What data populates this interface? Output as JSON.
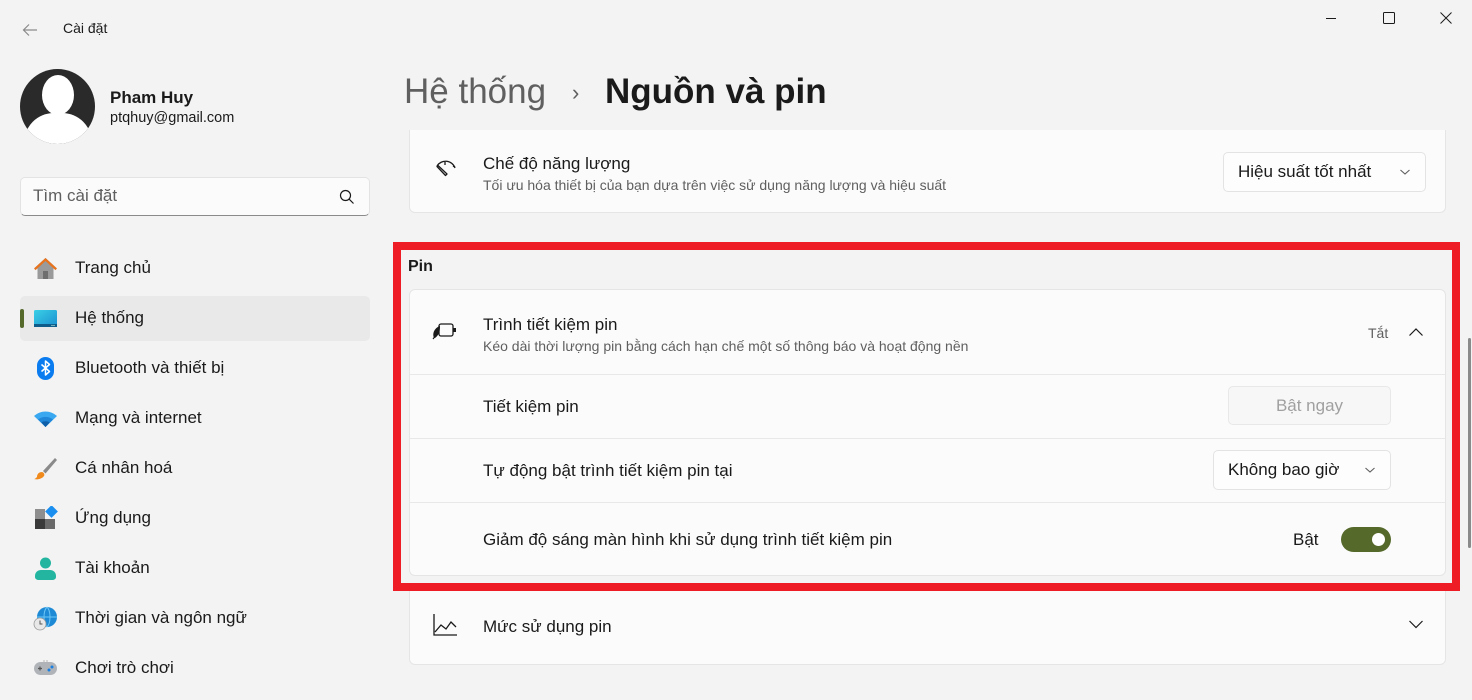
{
  "window": {
    "title": "Cài đặt",
    "controls": {
      "minimize": "minimize",
      "maximize": "maximize",
      "close": "close"
    }
  },
  "profile": {
    "name": "Pham Huy",
    "email": "ptqhuy@gmail.com"
  },
  "search": {
    "placeholder": "Tìm cài đặt",
    "value": ""
  },
  "sidebar": {
    "selected_index": 1,
    "accent": "#55692b",
    "items": [
      {
        "label": "Trang chủ",
        "icon": "home-icon"
      },
      {
        "label": "Hệ thống",
        "icon": "system-icon"
      },
      {
        "label": "Bluetooth và thiết bị",
        "icon": "bluetooth-icon"
      },
      {
        "label": "Mạng và internet",
        "icon": "wifi-icon"
      },
      {
        "label": "Cá nhân hoá",
        "icon": "paintbrush-icon"
      },
      {
        "label": "Ứng dụng",
        "icon": "apps-icon"
      },
      {
        "label": "Tài khoản",
        "icon": "account-icon"
      },
      {
        "label": "Thời gian và ngôn ngữ",
        "icon": "time-language-icon"
      },
      {
        "label": "Chơi trò chơi",
        "icon": "gamepad-icon"
      }
    ]
  },
  "breadcrumb": {
    "parent": "Hệ thống",
    "separator": "›",
    "current": "Nguồn và pin"
  },
  "power_mode": {
    "title": "Chế độ năng lượng",
    "description": "Tối ưu hóa thiết bị của bạn dựa trên việc sử dụng năng lượng và hiệu suất",
    "selected": "Hiệu suất tốt nhất"
  },
  "battery_section": {
    "label": "Pin",
    "saver": {
      "title": "Trình tiết kiệm pin",
      "description": "Kéo dài thời lượng pin bằng cách hạn chế một số thông báo và hoạt động nền",
      "status": "Tắt",
      "expanded": true,
      "rows": {
        "now": {
          "label": "Tiết kiệm pin",
          "button": "Bật ngay",
          "button_enabled": false
        },
        "auto": {
          "label": "Tự động bật trình tiết kiệm pin tại",
          "selected": "Không bao giờ"
        },
        "brightness": {
          "label": "Giảm độ sáng màn hình khi sử dụng trình tiết kiệm pin",
          "state_label": "Bật",
          "on": true
        }
      }
    },
    "usage": {
      "title": "Mức sử dụng pin",
      "expanded": false
    }
  },
  "annotation": {
    "color": "#ee1c25"
  }
}
